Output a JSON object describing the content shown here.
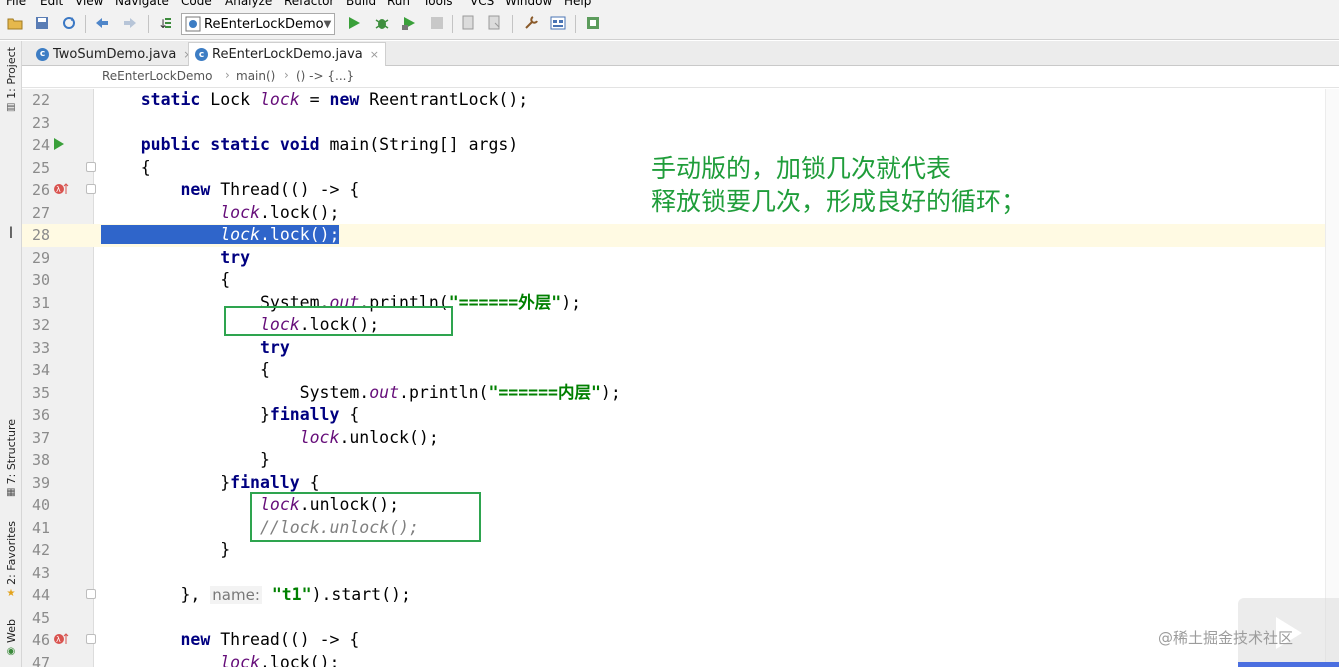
{
  "menu": [
    "File",
    "Edit",
    "View",
    "Navigate",
    "Code",
    "Analyze",
    "Refactor",
    "Build",
    "Run",
    "Tools",
    "VCS",
    "Window",
    "Help"
  ],
  "toolbar": {
    "run_config": "ReEnterLockDemo"
  },
  "side_tabs": {
    "project": "1: Project",
    "structure": "7: Structure",
    "favorites": "2: Favorites",
    "web": "Web"
  },
  "tabs": [
    {
      "label": "TwoSumDemo.java",
      "close": "×"
    },
    {
      "label": "ReEnterLockDemo.java",
      "close": "×"
    }
  ],
  "breadcrumb": [
    "ReEnterLockDemo",
    "main()",
    "() -> {...}"
  ],
  "editor": {
    "lines": [
      {
        "n": "22",
        "parts": [
          {
            "c": "    ",
            "s": "t"
          },
          {
            "c": "static",
            "s": "kw"
          },
          {
            "c": " Lock ",
            "s": "t"
          },
          {
            "c": "lock",
            "s": "fld"
          },
          {
            "c": " = ",
            "s": "t"
          },
          {
            "c": "new",
            "s": "kw"
          },
          {
            "c": " ReentrantLock();",
            "s": "t"
          }
        ]
      },
      {
        "n": "23",
        "parts": []
      },
      {
        "n": "24",
        "marker": "run",
        "parts": [
          {
            "c": "    ",
            "s": "t"
          },
          {
            "c": "public static void",
            "s": "kw"
          },
          {
            "c": " main(String[] args)",
            "s": "t"
          }
        ]
      },
      {
        "n": "25",
        "fold": true,
        "parts": [
          {
            "c": "    {",
            "s": "t"
          }
        ]
      },
      {
        "n": "26",
        "marker": "lambda",
        "fold": true,
        "parts": [
          {
            "c": "        ",
            "s": "t"
          },
          {
            "c": "new",
            "s": "kw"
          },
          {
            "c": " Thread(() -> {",
            "s": "t"
          }
        ]
      },
      {
        "n": "27",
        "parts": [
          {
            "c": "            ",
            "s": "t"
          },
          {
            "c": "lock",
            "s": "fld"
          },
          {
            "c": ".lock();",
            "s": "t"
          }
        ]
      },
      {
        "n": "28",
        "caret": true,
        "selected": true,
        "parts": [
          {
            "c": "            ",
            "s": "t"
          },
          {
            "c": "lock",
            "s": "fld"
          },
          {
            "c": ".lock();",
            "s": "t"
          }
        ]
      },
      {
        "n": "29",
        "parts": [
          {
            "c": "            ",
            "s": "t"
          },
          {
            "c": "try",
            "s": "kw"
          }
        ]
      },
      {
        "n": "30",
        "parts": [
          {
            "c": "            {",
            "s": "t"
          }
        ]
      },
      {
        "n": "31",
        "parts": [
          {
            "c": "                System.",
            "s": "t"
          },
          {
            "c": "out",
            "s": "fld"
          },
          {
            "c": ".println(",
            "s": "t"
          },
          {
            "c": "\"======外层\"",
            "s": "str"
          },
          {
            "c": ");",
            "s": "t"
          }
        ]
      },
      {
        "n": "32",
        "parts": [
          {
            "c": "                ",
            "s": "t"
          },
          {
            "c": "lock",
            "s": "fld"
          },
          {
            "c": ".lock();",
            "s": "t"
          }
        ]
      },
      {
        "n": "33",
        "parts": [
          {
            "c": "                ",
            "s": "t"
          },
          {
            "c": "try",
            "s": "kw"
          }
        ]
      },
      {
        "n": "34",
        "parts": [
          {
            "c": "                {",
            "s": "t"
          }
        ]
      },
      {
        "n": "35",
        "parts": [
          {
            "c": "                    System.",
            "s": "t"
          },
          {
            "c": "out",
            "s": "fld"
          },
          {
            "c": ".println(",
            "s": "t"
          },
          {
            "c": "\"======内层\"",
            "s": "str"
          },
          {
            "c": ");",
            "s": "t"
          }
        ]
      },
      {
        "n": "36",
        "parts": [
          {
            "c": "                }",
            "s": "t"
          },
          {
            "c": "finally",
            "s": "kw"
          },
          {
            "c": " {",
            "s": "t"
          }
        ]
      },
      {
        "n": "37",
        "parts": [
          {
            "c": "                    ",
            "s": "t"
          },
          {
            "c": "lock",
            "s": "fld"
          },
          {
            "c": ".unlock();",
            "s": "t"
          }
        ]
      },
      {
        "n": "38",
        "parts": [
          {
            "c": "                }",
            "s": "t"
          }
        ]
      },
      {
        "n": "39",
        "parts": [
          {
            "c": "            }",
            "s": "t"
          },
          {
            "c": "finally",
            "s": "kw"
          },
          {
            "c": " {",
            "s": "t"
          }
        ]
      },
      {
        "n": "40",
        "parts": [
          {
            "c": "                ",
            "s": "t"
          },
          {
            "c": "lock",
            "s": "fld"
          },
          {
            "c": ".unlock();",
            "s": "t"
          }
        ]
      },
      {
        "n": "41",
        "parts": [
          {
            "c": "                ",
            "s": "t"
          },
          {
            "c": "//lock.unlock();",
            "s": "cmt"
          }
        ]
      },
      {
        "n": "42",
        "parts": [
          {
            "c": "            }",
            "s": "t"
          }
        ]
      },
      {
        "n": "43",
        "parts": []
      },
      {
        "n": "44",
        "fold": true,
        "parts": [
          {
            "c": "        }, ",
            "s": "t"
          },
          {
            "c": "name:",
            "s": "hint"
          },
          {
            "c": " ",
            "s": "t"
          },
          {
            "c": "\"t1\"",
            "s": "str"
          },
          {
            "c": ").start();",
            "s": "t"
          }
        ]
      },
      {
        "n": "45",
        "parts": []
      },
      {
        "n": "46",
        "marker": "lambda",
        "fold": true,
        "parts": [
          {
            "c": "        ",
            "s": "t"
          },
          {
            "c": "new",
            "s": "kw"
          },
          {
            "c": " Thread(() -> {",
            "s": "t"
          }
        ]
      },
      {
        "n": "47",
        "parts": [
          {
            "c": "            ",
            "s": "t"
          },
          {
            "c": "lock",
            "s": "fld"
          },
          {
            "c": ".lock();",
            "s": "t"
          }
        ]
      }
    ]
  },
  "annotation": {
    "line1": "手动版的，加锁几次就代表",
    "line2": "释放锁要几次，形成良好的循环；"
  },
  "watermark": "@稀土掘金技术社区",
  "colors": {
    "keyword": "#000080",
    "field": "#660e7a",
    "string": "#008000",
    "comment": "#808080",
    "selection": "#2f65ca",
    "annotation": "#1f9d3a",
    "highlight_box": "#2ea44f"
  }
}
